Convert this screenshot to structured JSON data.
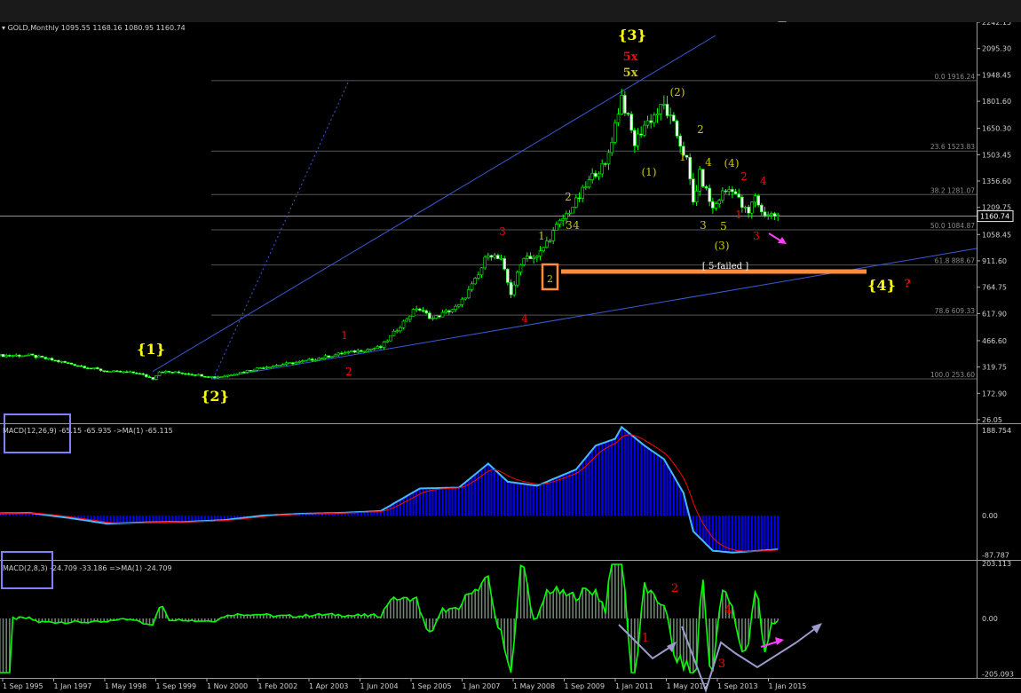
{
  "header": {
    "symbol_title": "GOLD,Monthly",
    "ohlc": "1095.55 1168.16 1080.95 1160.74"
  },
  "macd1": {
    "label": "MACD(12,26,9) -65.15 -65.935 ->MA(1) -65.115"
  },
  "macd2": {
    "label": "MACD(2,8,3) -24.709 -33.186 =>MA(1) -24.709"
  },
  "chart_data": [
    {
      "type": "candlestick",
      "title": "GOLD,Monthly",
      "y_scale": "linear",
      "y_ticks": [
        "2242.15",
        "2095.30",
        "1948.45",
        "1801.60",
        "1650.30",
        "1503.45",
        "1356.60",
        "1209.75",
        "1058.45",
        "911.60",
        "764.75",
        "617.90",
        "466.60",
        "319.75",
        "172.90",
        "26.05"
      ],
      "current_price": "1160.74",
      "x_tick_labels": [
        "1 Sep 1995",
        "1 Jan 1997",
        "1 May 1998",
        "1 Sep 1999",
        "1 Nov 2000",
        "1 Feb 2002",
        "1 Apr 2003",
        "1 Jun 2004",
        "1 Sep 2005",
        "1 Jan 2007",
        "1 May 2008",
        "1 Sep 2009",
        "1 Jan 2011",
        "1 May 2012",
        "1 Sep 2013",
        "1 Jan 2015"
      ],
      "close_path": [
        [
          "1995-09",
          384
        ],
        [
          "1996-06",
          385
        ],
        [
          "1997-06",
          340
        ],
        [
          "1998-06",
          295
        ],
        [
          "1999-03",
          287
        ],
        [
          "1999-08",
          255
        ],
        [
          "1999-10",
          295
        ],
        [
          "2000-06",
          285
        ],
        [
          "2001-03",
          263
        ],
        [
          "2001-06",
          270
        ],
        [
          "2002-06",
          320
        ],
        [
          "2003-06",
          350
        ],
        [
          "2004-06",
          395
        ],
        [
          "2005-06",
          430
        ],
        [
          "2006-05",
          650
        ],
        [
          "2006-10",
          590
        ],
        [
          "2007-06",
          660
        ],
        [
          "2007-12",
          830
        ],
        [
          "2008-03",
          960
        ],
        [
          "2008-07",
          910
        ],
        [
          "2008-10",
          730
        ],
        [
          "2009-02",
          940
        ],
        [
          "2009-06",
          930
        ],
        [
          "2009-12",
          1100
        ],
        [
          "2010-06",
          1240
        ],
        [
          "2010-12",
          1410
        ],
        [
          "2011-03",
          1440
        ],
        [
          "2011-08",
          1830
        ],
        [
          "2011-12",
          1565
        ],
        [
          "2012-03",
          1670
        ],
        [
          "2012-09",
          1775
        ],
        [
          "2012-12",
          1660
        ],
        [
          "2013-04",
          1470
        ],
        [
          "2013-06",
          1235
        ],
        [
          "2013-08",
          1395
        ],
        [
          "2013-12",
          1200
        ],
        [
          "2014-03",
          1290
        ],
        [
          "2014-06",
          1320
        ],
        [
          "2014-09",
          1215
        ],
        [
          "2014-11",
          1175
        ],
        [
          "2015-01",
          1280
        ],
        [
          "2015-03",
          1180
        ],
        [
          "2015-06",
          1170
        ],
        [
          "2015-08",
          1160
        ]
      ],
      "fibonacci_levels": [
        {
          "label": "0.0",
          "value": "1916.24"
        },
        {
          "label": "23.6",
          "value": "1523.83"
        },
        {
          "label": "38.2",
          "value": "1281.07"
        },
        {
          "label": "50.0",
          "value": "1084.87"
        },
        {
          "label": "61.8",
          "value": "888.67"
        },
        {
          "label": "78.6",
          "value": "609.33"
        },
        {
          "label": "100.0",
          "value": "253.60"
        }
      ],
      "annotations": [
        {
          "text": "{1}",
          "color": "#ffff00"
        },
        {
          "text": "{2}",
          "color": "#ffff00"
        },
        {
          "text": "{3}",
          "color": "#ffff00"
        },
        {
          "text": "{4}",
          "color": "#ffff00"
        },
        {
          "text": "?",
          "color": "#ff0000"
        },
        {
          "text": "5x",
          "color": "#ff0000"
        },
        {
          "text": "5x",
          "color": "#c8c800"
        },
        {
          "text": "1",
          "color": "#ff0000"
        },
        {
          "text": "2",
          "color": "#ff0000"
        },
        {
          "text": "3",
          "color": "#ff0000"
        },
        {
          "text": "4",
          "color": "#ff0000"
        },
        {
          "text": "1",
          "color": "#c8c800"
        },
        {
          "text": "2",
          "color": "#c8c800"
        },
        {
          "text": "3",
          "color": "#c8c800"
        },
        {
          "text": "4",
          "color": "#c8c800"
        },
        {
          "text": "(1)",
          "color": "#c8c800"
        },
        {
          "text": "(2)",
          "color": "#c8c800"
        },
        {
          "text": "2",
          "color": "#c8c800"
        },
        {
          "text": "1",
          "color": "#c8c800"
        },
        {
          "text": "4",
          "color": "#c8c800"
        },
        {
          "text": "(4)",
          "color": "#c8c800"
        },
        {
          "text": "2",
          "color": "#ff0000"
        },
        {
          "text": "4",
          "color": "#ff0000"
        },
        {
          "text": "1",
          "color": "#ff0000"
        },
        {
          "text": "3",
          "color": "#c8c800"
        },
        {
          "text": "5",
          "color": "#c8c800"
        },
        {
          "text": "(3)",
          "color": "#c8c800"
        },
        {
          "text": "3",
          "color": "#ff0000"
        },
        {
          "text": "[ 5-failed ]",
          "color": "#ffffff"
        }
      ]
    },
    {
      "type": "area",
      "title": "MACD(12,26,9) -65.15 -65.935 ->MA(1) -65.115",
      "y_ticks": [
        "188.754",
        "0.00",
        "-87.787"
      ],
      "series": [
        {
          "name": "MACD histogram",
          "color": "#0000ff"
        },
        {
          "name": "MA(1)",
          "color": "#44bbff"
        },
        {
          "name": "Signal",
          "color": "#ff0000"
        }
      ],
      "values": [
        [
          "1995-09",
          5
        ],
        [
          "1996-06",
          6
        ],
        [
          "1997-06",
          -5
        ],
        [
          "1998-06",
          -18
        ],
        [
          "1999-06",
          -15
        ],
        [
          "2000-06",
          -14
        ],
        [
          "2001-06",
          -10
        ],
        [
          "2002-06",
          0
        ],
        [
          "2003-06",
          4
        ],
        [
          "2004-06",
          6
        ],
        [
          "2005-06",
          10
        ],
        [
          "2006-06",
          60
        ],
        [
          "2007-06",
          62
        ],
        [
          "2008-03",
          115
        ],
        [
          "2008-09",
          75
        ],
        [
          "2009-06",
          66
        ],
        [
          "2010-06",
          102
        ],
        [
          "2010-12",
          155
        ],
        [
          "2011-06",
          170
        ],
        [
          "2011-08",
          196
        ],
        [
          "2012-03",
          155
        ],
        [
          "2012-09",
          125
        ],
        [
          "2013-03",
          50
        ],
        [
          "2013-06",
          -35
        ],
        [
          "2013-12",
          -78
        ],
        [
          "2014-06",
          -82
        ],
        [
          "2015-08",
          -75
        ]
      ]
    },
    {
      "type": "area",
      "title": "MACD(2,8,3) -24.709 -33.186 =>MA(1) -24.709",
      "y_ticks": [
        "203.113",
        "0.00",
        "-205.093"
      ],
      "series": [
        {
          "name": "MACD histogram",
          "color": "#778877"
        },
        {
          "name": "MA(1)",
          "color": "#00ff00"
        }
      ],
      "annotations": [
        {
          "text": "1",
          "color": "#ff0000"
        },
        {
          "text": "2",
          "color": "#ff0000"
        },
        {
          "text": "3",
          "color": "#ff0000"
        },
        {
          "text": "4",
          "color": "#ff0000"
        }
      ]
    }
  ]
}
